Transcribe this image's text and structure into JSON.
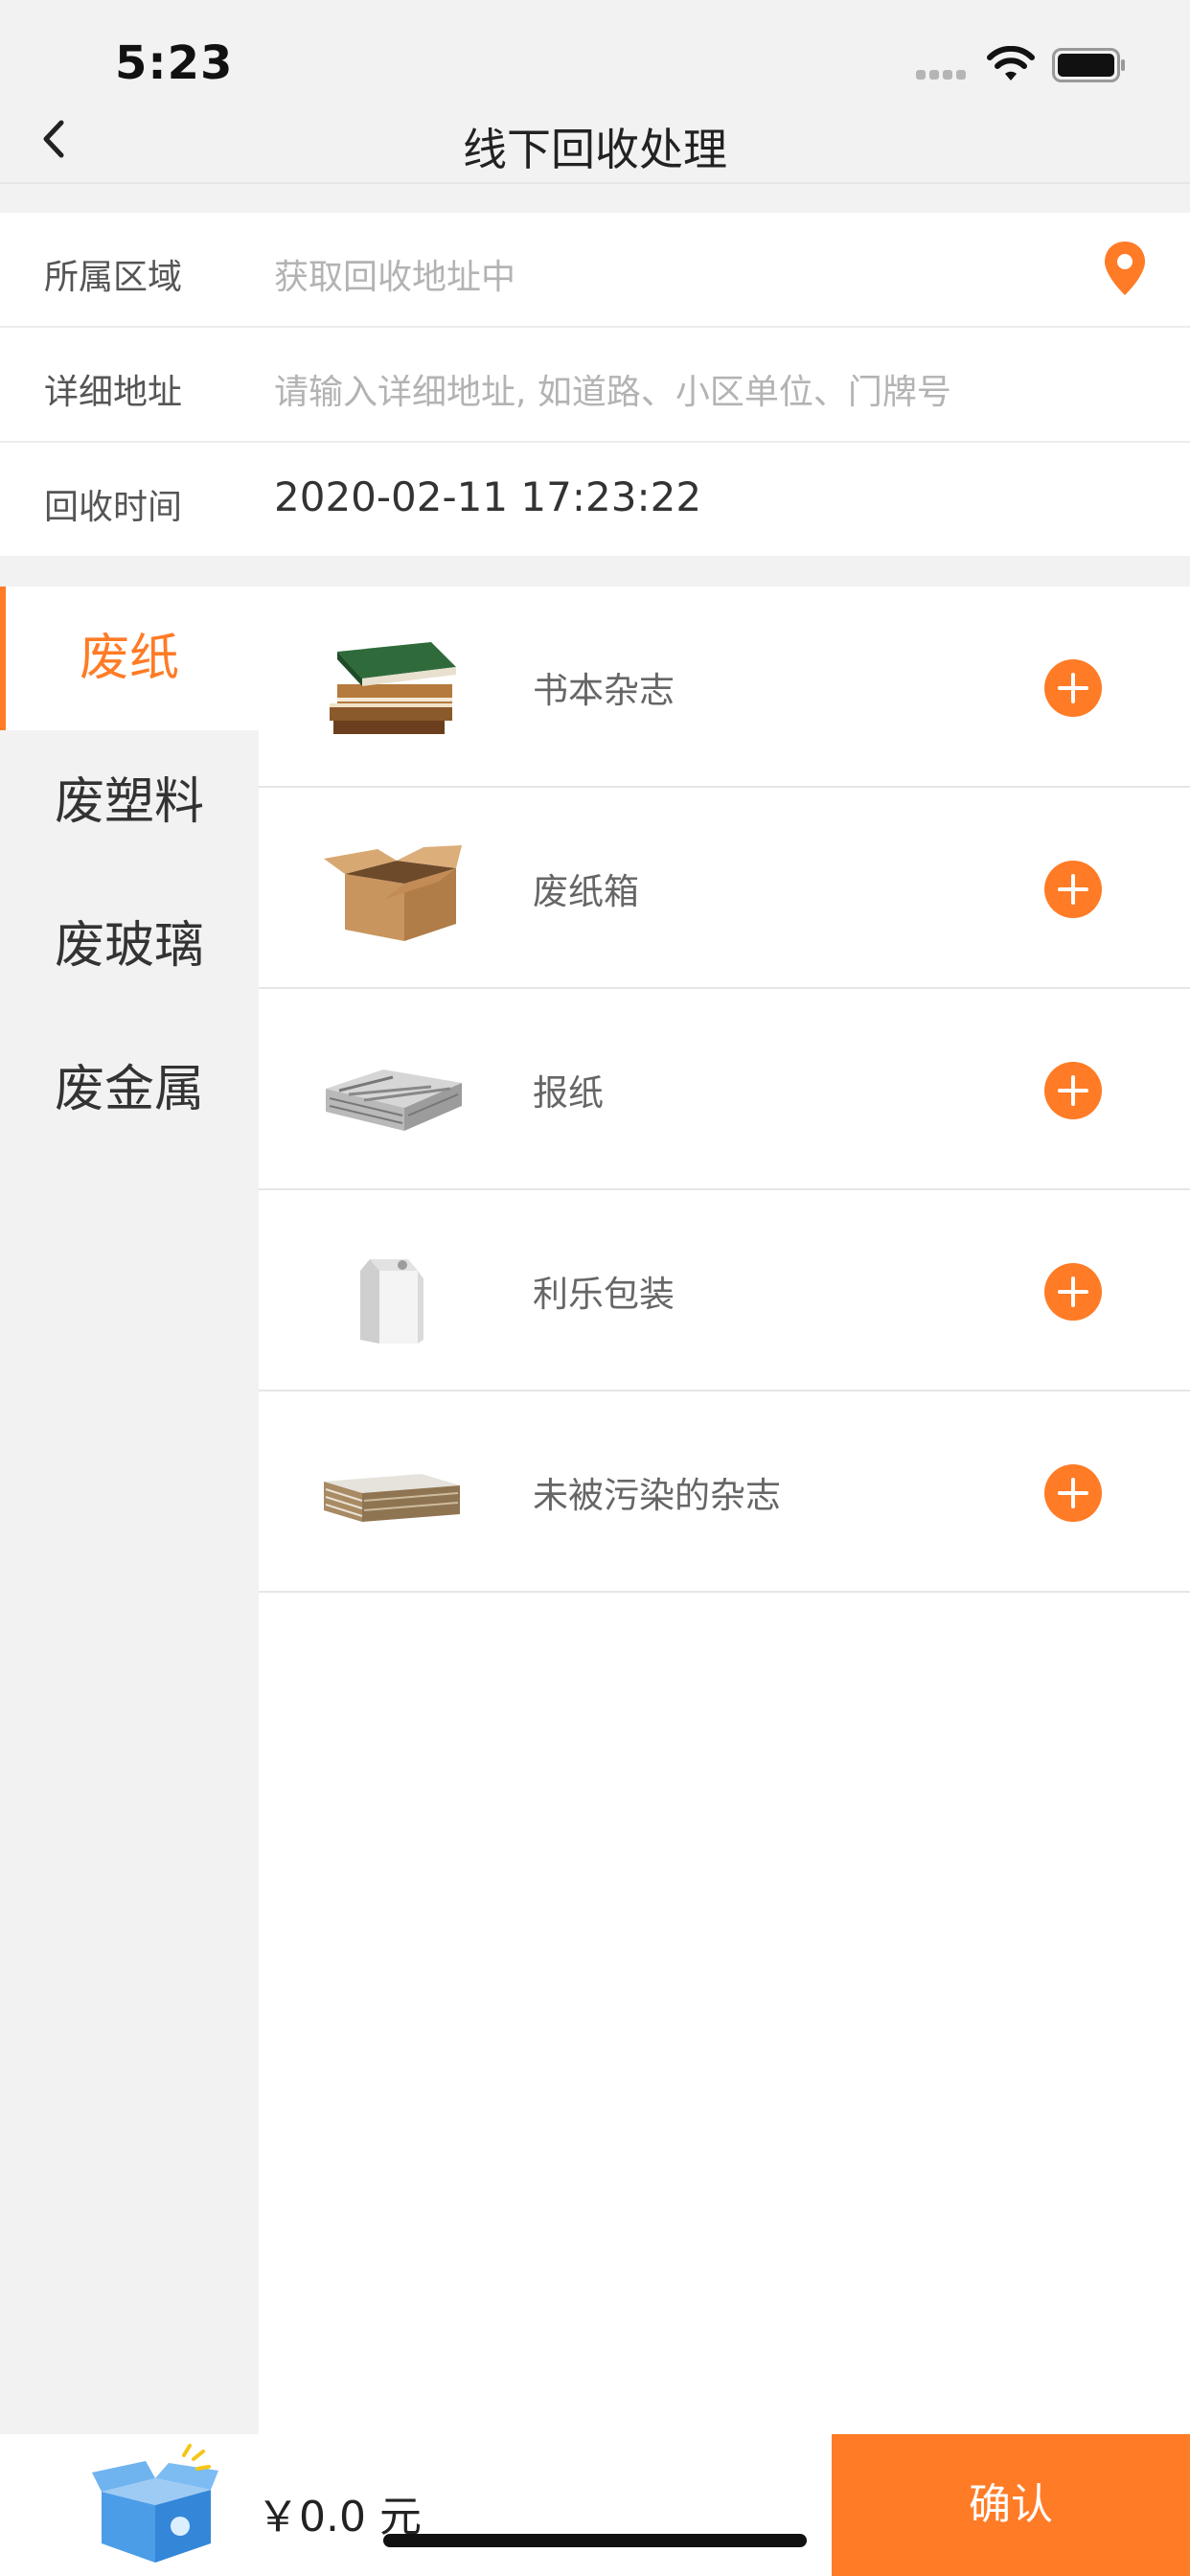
{
  "status_bar": {
    "time": "5:23"
  },
  "nav": {
    "title": "线下回收处理"
  },
  "form": {
    "region_label": "所属区域",
    "region_value": "获取回收地址中",
    "address_label": "详细地址",
    "address_placeholder": "请输入详细地址, 如道路、小区单位、门牌号",
    "time_label": "回收时间",
    "time_value": "2020-02-11 17:23:22"
  },
  "categories": [
    {
      "label": "废纸",
      "active": true
    },
    {
      "label": "废塑料",
      "active": false
    },
    {
      "label": "废玻璃",
      "active": false
    },
    {
      "label": "废金属",
      "active": false
    }
  ],
  "items": [
    {
      "name": "书本杂志",
      "icon": "books-icon"
    },
    {
      "name": "废纸箱",
      "icon": "cardboard-box-icon"
    },
    {
      "name": "报纸",
      "icon": "newspaper-icon"
    },
    {
      "name": "利乐包装",
      "icon": "carton-icon"
    },
    {
      "name": "未被污染的杂志",
      "icon": "magazine-stack-icon"
    }
  ],
  "bottom": {
    "total": "￥0.0 元",
    "confirm_label": "确认"
  },
  "colors": {
    "accent": "#ff7b26",
    "background": "#f2f2f2"
  }
}
